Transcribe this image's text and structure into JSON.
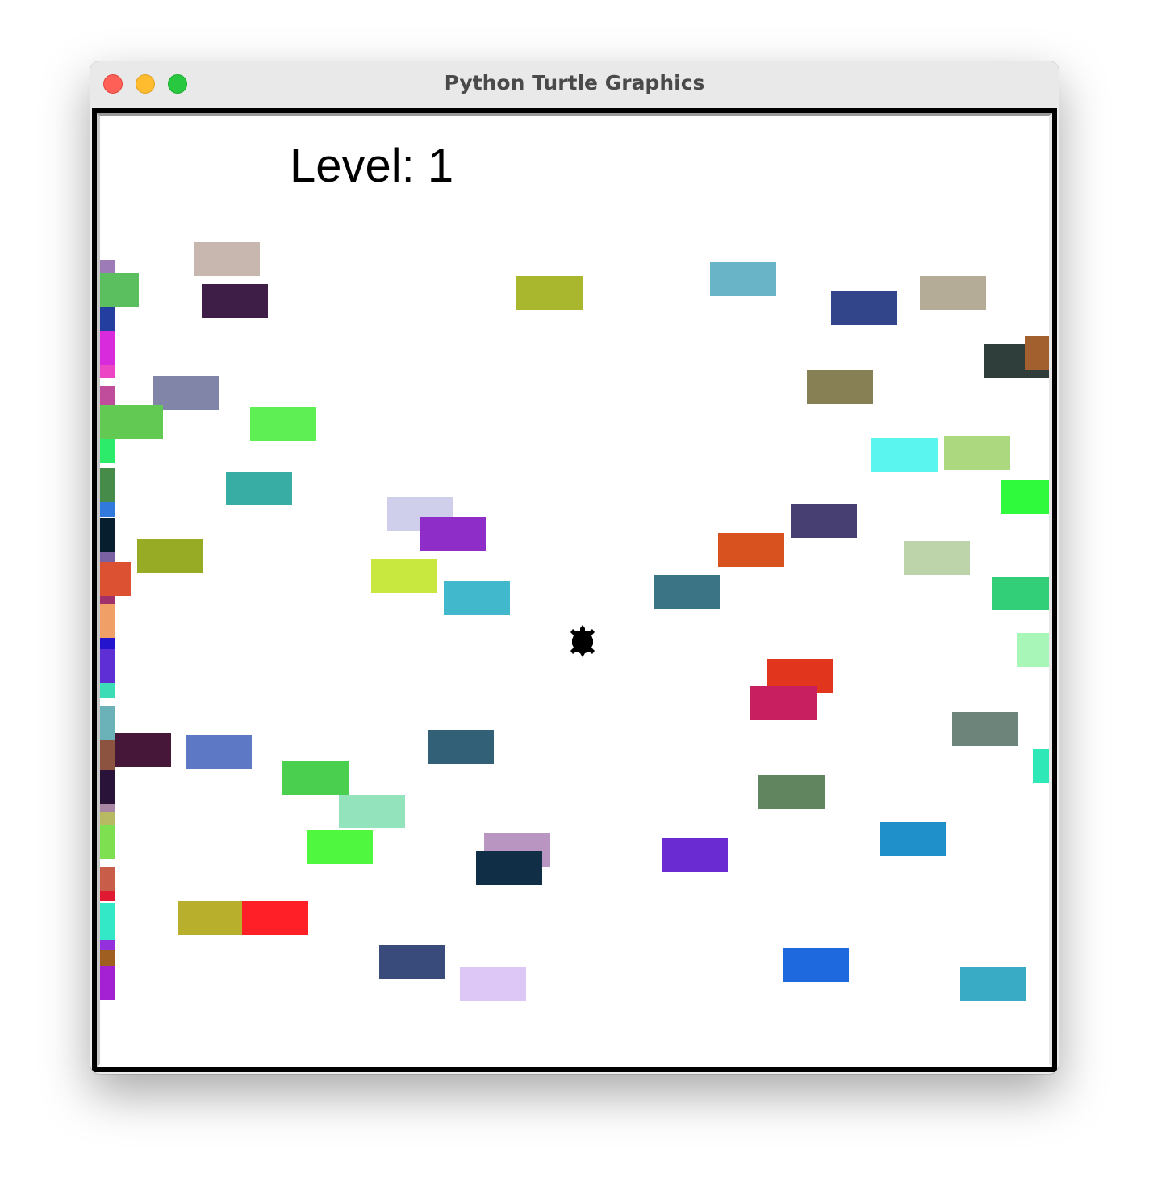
{
  "window": {
    "title": "Python Turtle Graphics"
  },
  "hud": {
    "level_text": "Level: 1"
  },
  "player": {
    "icon": "turtle-icon",
    "color": "#000000"
  },
  "cars": [
    {
      "color": "#c8b7ae"
    },
    {
      "color": "#3e1e47"
    },
    {
      "color": "#a8b72d"
    },
    {
      "color": "#6ab4c8"
    },
    {
      "color": "#33458a"
    },
    {
      "color": "#b4ac97"
    },
    {
      "color": "#2f3d3b"
    },
    {
      "color": "#a2602e"
    },
    {
      "color": "#878054"
    },
    {
      "color": "#8186a9"
    },
    {
      "color": "#5eef54"
    },
    {
      "color": "#37ada3"
    },
    {
      "color": "#5bf5ef"
    },
    {
      "color": "#acd97f"
    },
    {
      "color": "#2ffa3b"
    },
    {
      "color": "#cfcfec"
    },
    {
      "color": "#8e2dc8"
    },
    {
      "color": "#473e72"
    },
    {
      "color": "#d8521f"
    },
    {
      "color": "#bdd4ab"
    },
    {
      "color": "#97ab25"
    },
    {
      "color": "#c8e840"
    },
    {
      "color": "#42b8cc"
    },
    {
      "color": "#3b7484"
    },
    {
      "color": "#33cf78"
    },
    {
      "color": "#a8f7b9"
    },
    {
      "color": "#e2351e"
    },
    {
      "color": "#c81f60"
    },
    {
      "color": "#6c847a"
    },
    {
      "color": "#461738"
    },
    {
      "color": "#5d79c5"
    },
    {
      "color": "#326077"
    },
    {
      "color": "#2fe8b7"
    },
    {
      "color": "#4bcf4f"
    },
    {
      "color": "#93e3bc"
    },
    {
      "color": "#60855f"
    },
    {
      "color": "#4ff73f"
    },
    {
      "color": "#b896c1"
    },
    {
      "color": "#102e45"
    },
    {
      "color": "#6b2bd3"
    },
    {
      "color": "#1f90c9"
    },
    {
      "color": "#b8b02d"
    },
    {
      "color": "#fe2026"
    },
    {
      "color": "#394b7b"
    },
    {
      "color": "#dcc7f7"
    },
    {
      "color": "#1e69dd"
    },
    {
      "color": "#39abc5"
    },
    {
      "color": "#5bbf60"
    },
    {
      "color": "#62c952"
    },
    {
      "color": "#dc5132"
    },
    {
      "color": "#9c7bb6"
    },
    {
      "color": "#243ea0"
    },
    {
      "color": "#d72bdc"
    },
    {
      "color": "#ec46c4"
    },
    {
      "color": "#c04c9c"
    },
    {
      "color": "#2deb6a"
    },
    {
      "color": "#468b4a"
    },
    {
      "color": "#3179dc"
    },
    {
      "color": "#061e2e"
    },
    {
      "color": "#7a61a2"
    },
    {
      "color": "#a0306a"
    },
    {
      "color": "#f0a067"
    },
    {
      "color": "#2414cd"
    },
    {
      "color": "#5d2fd4"
    },
    {
      "color": "#3bdcb6"
    },
    {
      "color": "#6bb2b8"
    },
    {
      "color": "#8c5440"
    },
    {
      "color": "#2a1338"
    },
    {
      "color": "#a886a3"
    },
    {
      "color": "#b7ba63"
    },
    {
      "color": "#7edf50"
    },
    {
      "color": "#c85e4a"
    },
    {
      "color": "#e01a33"
    },
    {
      "color": "#32e8c7"
    },
    {
      "color": "#9430dc"
    },
    {
      "color": "#9e5f20"
    },
    {
      "color": "#a321d3"
    },
    {
      "color": "#23463c"
    }
  ]
}
